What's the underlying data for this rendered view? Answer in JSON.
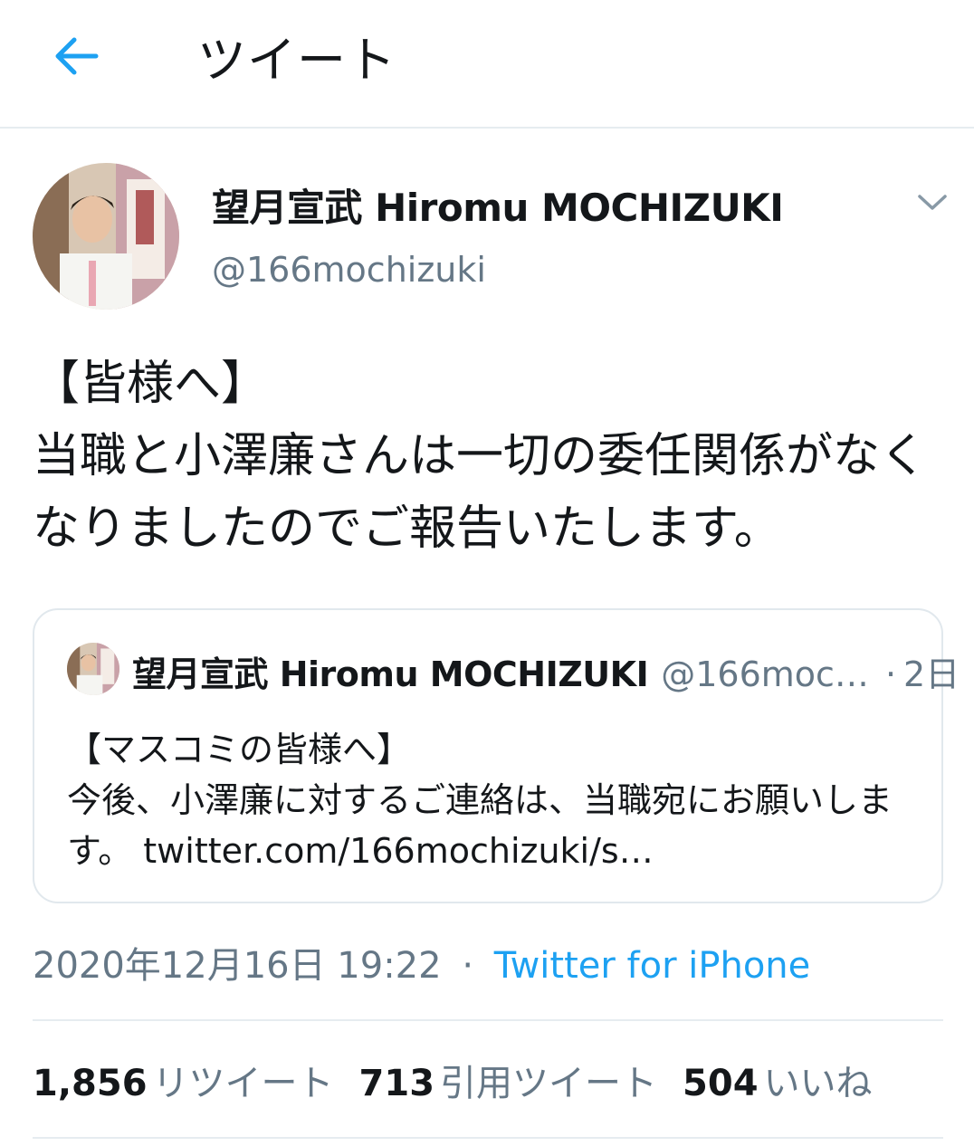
{
  "header": {
    "title": "ツイート",
    "back_icon": "arrow-left-icon",
    "accent_color": "#1da1f2"
  },
  "tweet": {
    "author_name": "望月宣武 Hiromu MOCHIZUKI",
    "author_handle": "@166mochizuki",
    "menu_icon": "chevron-down-icon",
    "text_lines": [
      "【皆様へ】",
      "当職と小澤廉さんは一切の委任関係がなく",
      "なりましたのでご報告いたします。"
    ],
    "timestamp": "2020年12月16日 19:22",
    "separator": "·",
    "source": "Twitter for iPhone"
  },
  "quoted": {
    "author_name": "望月宣武 Hiromu MOCHIZUKI",
    "author_handle": "@166moc…",
    "separator": "·",
    "time": "2日",
    "text_lines": [
      "【マスコミの皆様へ】",
      "今後、小澤廉に対するご連絡は、当職宛にお願いしま",
      "す。 twitter.com/166mochizuki/s…"
    ]
  },
  "stats": {
    "retweets_count": "1,856",
    "retweets_label": "リツイート",
    "quotes_count": "713",
    "quotes_label": "引用ツイート",
    "likes_count": "504",
    "likes_label": "いいね"
  }
}
